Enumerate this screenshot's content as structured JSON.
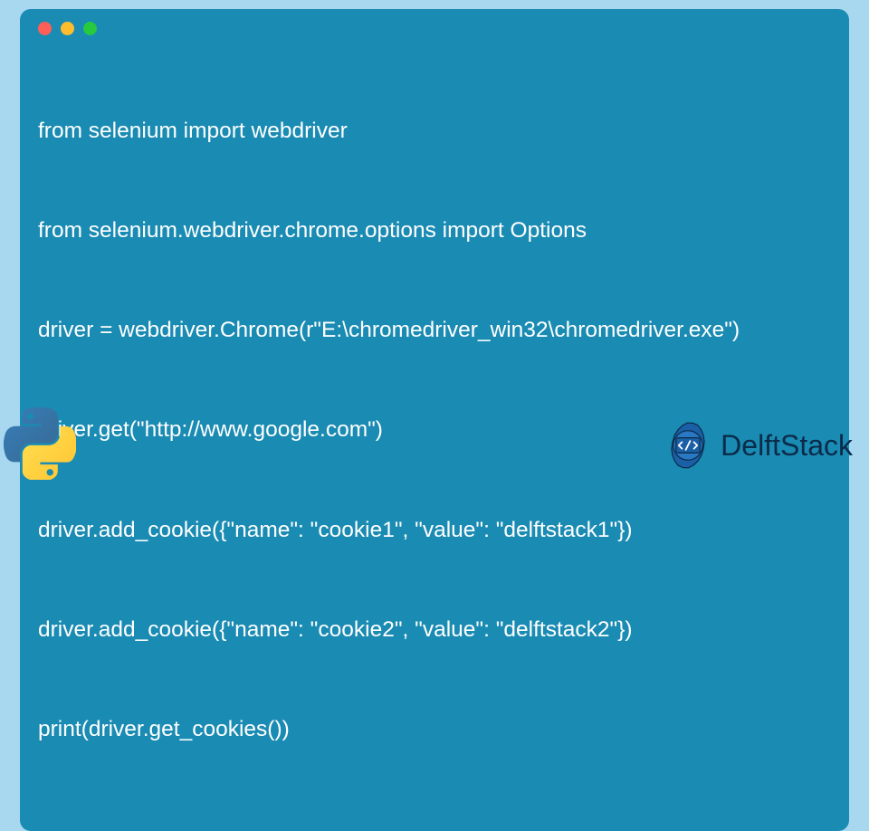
{
  "code": {
    "lines": [
      "from selenium import webdriver",
      "from selenium.webdriver.chrome.options import Options",
      "driver = webdriver.Chrome(r\"E:\\chromedriver_win32\\chromedriver.exe\")",
      "driver.get(\"http://www.google.com\")",
      "driver.add_cookie({\"name\": \"cookie1\", \"value\": \"delftstack1\"})",
      "driver.add_cookie({\"name\": \"cookie2\", \"value\": \"delftstack2\"})",
      "print(driver.get_cookies())"
    ]
  },
  "brand": {
    "name": "DelftStack"
  }
}
